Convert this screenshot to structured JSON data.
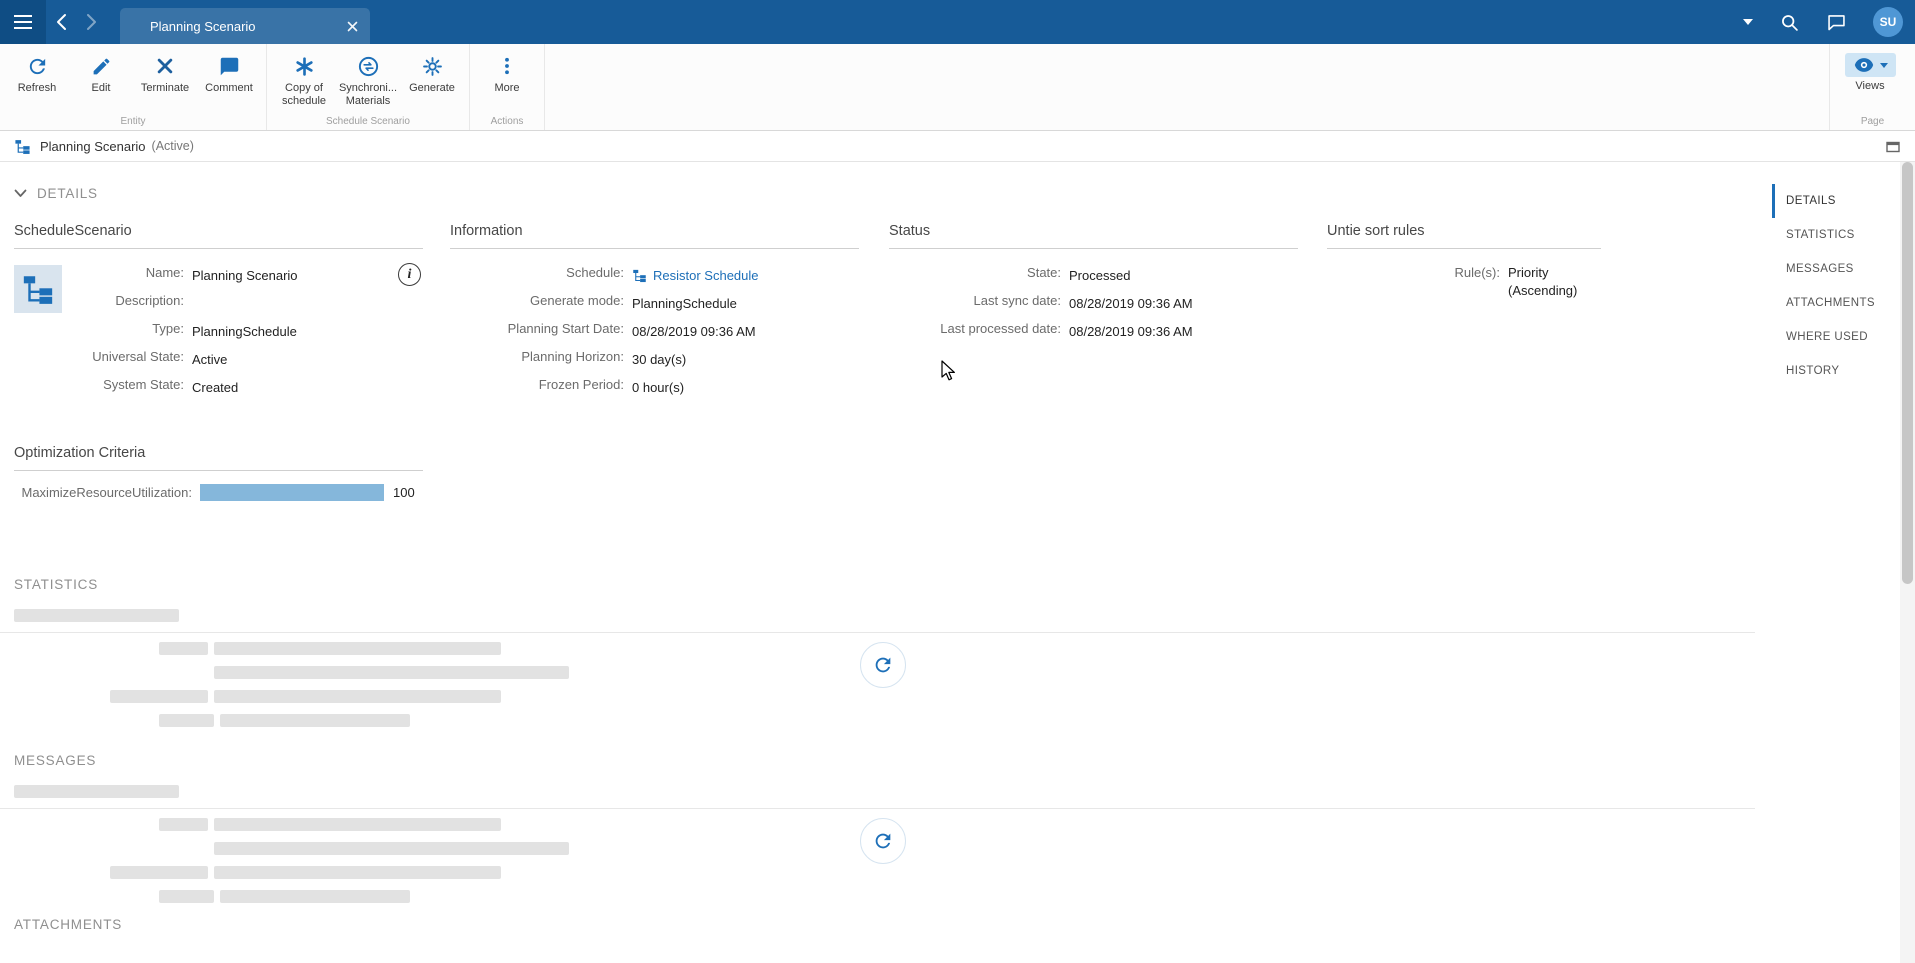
{
  "topbar": {
    "tab_title": "Planning Scenario",
    "avatar_initials": "SU"
  },
  "toolbar": {
    "buttons": {
      "refresh": "Refresh",
      "edit": "Edit",
      "terminate": "Terminate",
      "comment": "Comment",
      "copy_of_schedule": "Copy of schedule",
      "synchronize_materials": "Synchroni... Materials",
      "generate": "Generate",
      "more": "More",
      "views": "Views"
    },
    "groups": {
      "entity": "Entity",
      "schedule_scenario": "Schedule Scenario",
      "actions": "Actions",
      "page": "Page"
    }
  },
  "breadcrumb": {
    "title": "Planning Scenario",
    "status": "(Active)"
  },
  "right_nav": {
    "items": [
      "DETAILS",
      "STATISTICS",
      "MESSAGES",
      "ATTACHMENTS",
      "WHERE USED",
      "HISTORY"
    ],
    "active": "DETAILS"
  },
  "details": {
    "header": "DETAILS",
    "schedule_scenario": {
      "header": "ScheduleScenario",
      "fields": [
        {
          "label": "Name:",
          "value": "Planning Scenario"
        },
        {
          "label": "Description:",
          "value": ""
        },
        {
          "label": "Type:",
          "value": "PlanningSchedule"
        },
        {
          "label": "Universal State:",
          "value": "Active"
        },
        {
          "label": "System State:",
          "value": "Created"
        }
      ]
    },
    "information": {
      "header": "Information",
      "fields": [
        {
          "label": "Schedule:",
          "value": "Resistor Schedule"
        },
        {
          "label": "Generate mode:",
          "value": "PlanningSchedule"
        },
        {
          "label": "Planning Start Date:",
          "value": "08/28/2019 09:36 AM"
        },
        {
          "label": "Planning Horizon:",
          "value": "30 day(s)"
        },
        {
          "label": "Frozen Period:",
          "value": "0 hour(s)"
        }
      ]
    },
    "status": {
      "header": "Status",
      "fields": [
        {
          "label": "State:",
          "value": "Processed"
        },
        {
          "label": "Last sync date:",
          "value": "08/28/2019 09:36 AM"
        },
        {
          "label": "Last processed date:",
          "value": "08/28/2019 09:36 AM"
        }
      ]
    },
    "untie_sort_rules": {
      "header": "Untie sort rules",
      "fields": [
        {
          "label": "Rule(s):",
          "value": "Priority (Ascending)"
        }
      ]
    },
    "optimization": {
      "header": "Optimization Criteria",
      "label": "MaximizeResourceUtilization:",
      "value": 100,
      "max": 100
    }
  },
  "statistics": {
    "header": "STATISTICS"
  },
  "messages": {
    "header": "MESSAGES"
  },
  "attachments": {
    "header": "ATTACHMENTS"
  },
  "icons": {
    "menu": "hamburger",
    "back": "chevron-left",
    "forward": "chevron-right",
    "tab_close": "x",
    "dropdown": "caret-down",
    "search": "magnifier",
    "chat": "speech-bubble",
    "refresh": "circular-arrow",
    "edit": "pencil",
    "terminate": "x",
    "comment": "speech-bubble",
    "copy_of_schedule": "asterisk",
    "synchronize_materials": "sync-circle",
    "generate": "gear",
    "more": "vertical-dots",
    "views": "eye",
    "info": "info-circle",
    "type_schedule": "flowchart",
    "loading": "refresh-spinner",
    "expand": "window"
  },
  "colors": {
    "topbar": "#175b98",
    "accent": "#1d6fb8",
    "progress_fill": "#85b7db"
  }
}
